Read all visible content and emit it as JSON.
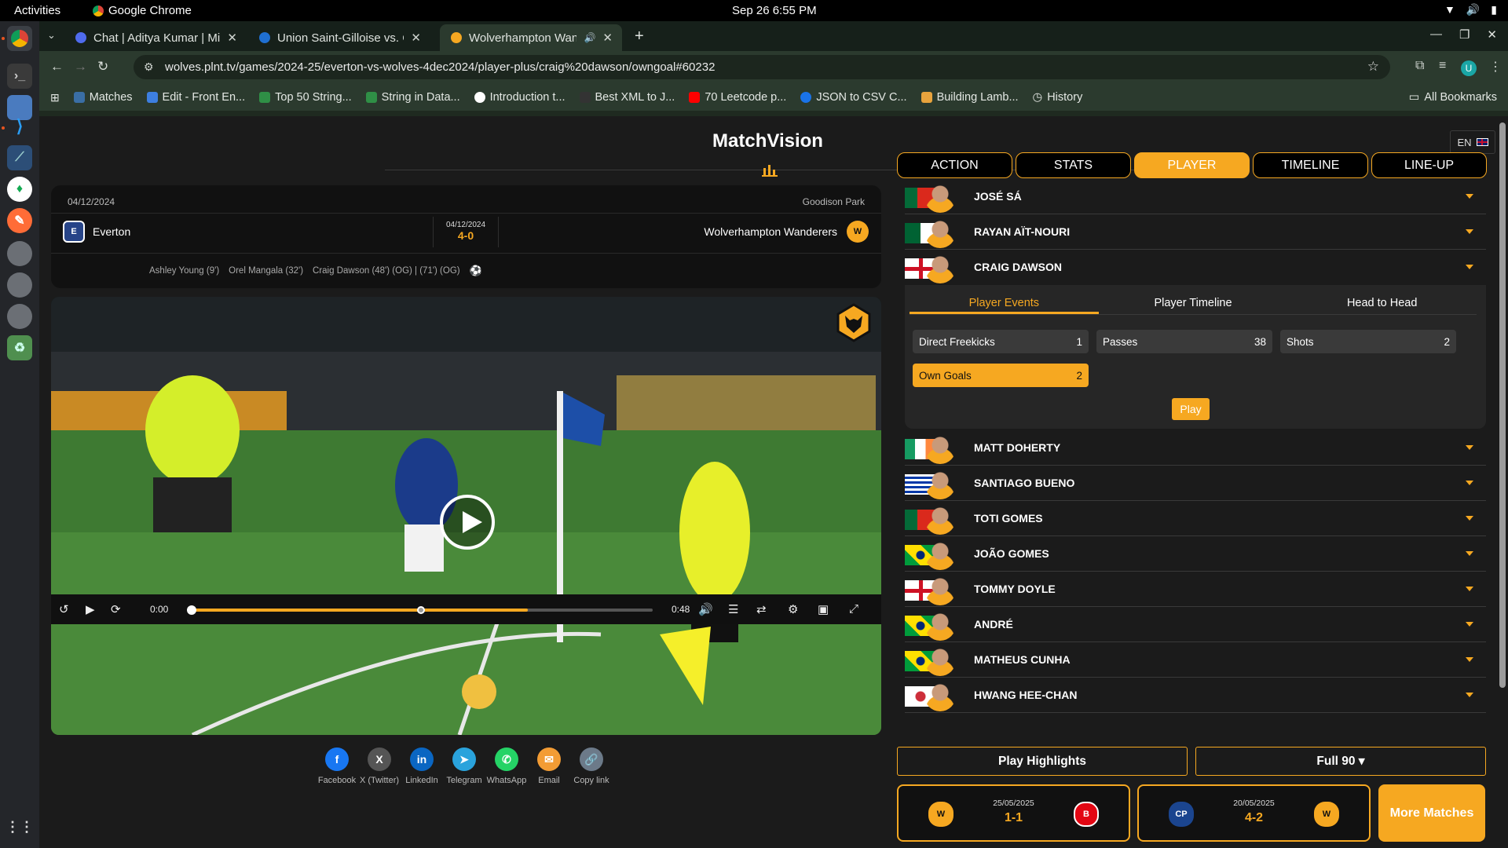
{
  "system": {
    "activities": "Activities",
    "app_name": "Google Chrome",
    "clock": "Sep 26  6:55 PM"
  },
  "browser": {
    "tabs": [
      {
        "title": "Chat | Aditya Kumar | Mi",
        "favicon_color": "#4f6bed"
      },
      {
        "title": "Union Saint-Gilloise vs. C",
        "favicon_color": "#1f6fd1"
      },
      {
        "title": "Wolverhampton Wan",
        "favicon_color": "#f6a821"
      }
    ],
    "url": "wolves.plnt.tv/games/2024-25/everton-vs-wolves-4dec2024/player-plus/craig%20dawson/owngoal#60232",
    "avatar_letter": "U",
    "bookmarks": [
      {
        "label": "Matches",
        "color": "#3a6ea5"
      },
      {
        "label": "Edit - Front En...",
        "color": "#3d7fe0"
      },
      {
        "label": "Top 50 String...",
        "color": "#2f8f46"
      },
      {
        "label": "String in Data...",
        "color": "#2f8f46"
      },
      {
        "label": "Introduction t...",
        "color": "#ffffff"
      },
      {
        "label": "Best XML to J...",
        "color": "#333333"
      },
      {
        "label": "70 Leetcode p...",
        "color": "#ff0000"
      },
      {
        "label": "JSON to CSV C...",
        "color": "#1a73e8"
      },
      {
        "label": "Building Lamb...",
        "color": "#e8a33d"
      },
      {
        "label": "History",
        "color": "#bbbbbb"
      }
    ],
    "all_bookmarks": "All Bookmarks"
  },
  "page": {
    "brand": "MatchVision",
    "language": "EN"
  },
  "match": {
    "date": "04/12/2024",
    "venue": "Goodison Park",
    "home": "Everton",
    "away": "Wolverhampton Wanderers",
    "mid_date": "04/12/2024",
    "score": "4-0",
    "goals": [
      "Ashley Young (9')",
      "Orel Mangala (32')",
      "Craig Dawson (48') (OG) | (71') (OG)"
    ]
  },
  "player_controls": {
    "current_time": "0:00",
    "duration": "0:48",
    "progress": 0,
    "buffered": 0.73,
    "marker": 0.5
  },
  "share": [
    {
      "label": "Facebook",
      "glyph": "f",
      "color": "#1877f2"
    },
    {
      "label": "X (Twitter)",
      "glyph": "X",
      "color": "#555555"
    },
    {
      "label": "LinkedIn",
      "glyph": "in",
      "color": "#0a66c2"
    },
    {
      "label": "Telegram",
      "glyph": "➤",
      "color": "#2aa3dc"
    },
    {
      "label": "WhatsApp",
      "glyph": "✆",
      "color": "#25d366"
    },
    {
      "label": "Email",
      "glyph": "✉",
      "color": "#f39c34"
    },
    {
      "label": "Copy link",
      "glyph": "🔗",
      "color": "#6c7a89"
    }
  ],
  "panel_tabs": [
    {
      "label": "ACTION",
      "active": false
    },
    {
      "label": "STATS",
      "active": false
    },
    {
      "label": "PLAYER",
      "active": true
    },
    {
      "label": "TIMELINE",
      "active": false
    },
    {
      "label": "LINE-UP",
      "active": false
    }
  ],
  "players_top": [
    {
      "name": "JOSÉ SÁ",
      "flag": "portugal"
    },
    {
      "name": "RAYAN AÏT-NOURI",
      "flag": "algeria"
    },
    {
      "name": "CRAIG DAWSON",
      "flag": "england"
    }
  ],
  "expanded": {
    "subtabs": [
      "Player Events",
      "Player Timeline",
      "Head to Head"
    ],
    "stats": [
      {
        "label": "Direct Freekicks",
        "value": "1",
        "active": false
      },
      {
        "label": "Passes",
        "value": "38",
        "active": false
      },
      {
        "label": "Shots",
        "value": "2",
        "active": false
      },
      {
        "label": "Own Goals",
        "value": "2",
        "active": true
      }
    ],
    "play_label": "Play"
  },
  "players_bottom": [
    {
      "name": "MATT DOHERTY",
      "flag": "ireland"
    },
    {
      "name": "SANTIAGO BUENO",
      "flag": "uruguay"
    },
    {
      "name": "TOTI GOMES",
      "flag": "portugal"
    },
    {
      "name": "JOÃO GOMES",
      "flag": "brazil"
    },
    {
      "name": "TOMMY DOYLE",
      "flag": "england"
    },
    {
      "name": "ANDRÉ",
      "flag": "brazil"
    },
    {
      "name": "MATHEUS CUNHA",
      "flag": "brazil"
    },
    {
      "name": "HWANG HEE-CHAN",
      "flag": "korea"
    }
  ],
  "footer": {
    "highlights": "Play Highlights",
    "full": "Full 90 ▾",
    "matches": [
      {
        "date": "25/05/2025",
        "score": "1-1"
      },
      {
        "date": "20/05/2025",
        "score": "4-2"
      }
    ],
    "more": "More Matches"
  }
}
